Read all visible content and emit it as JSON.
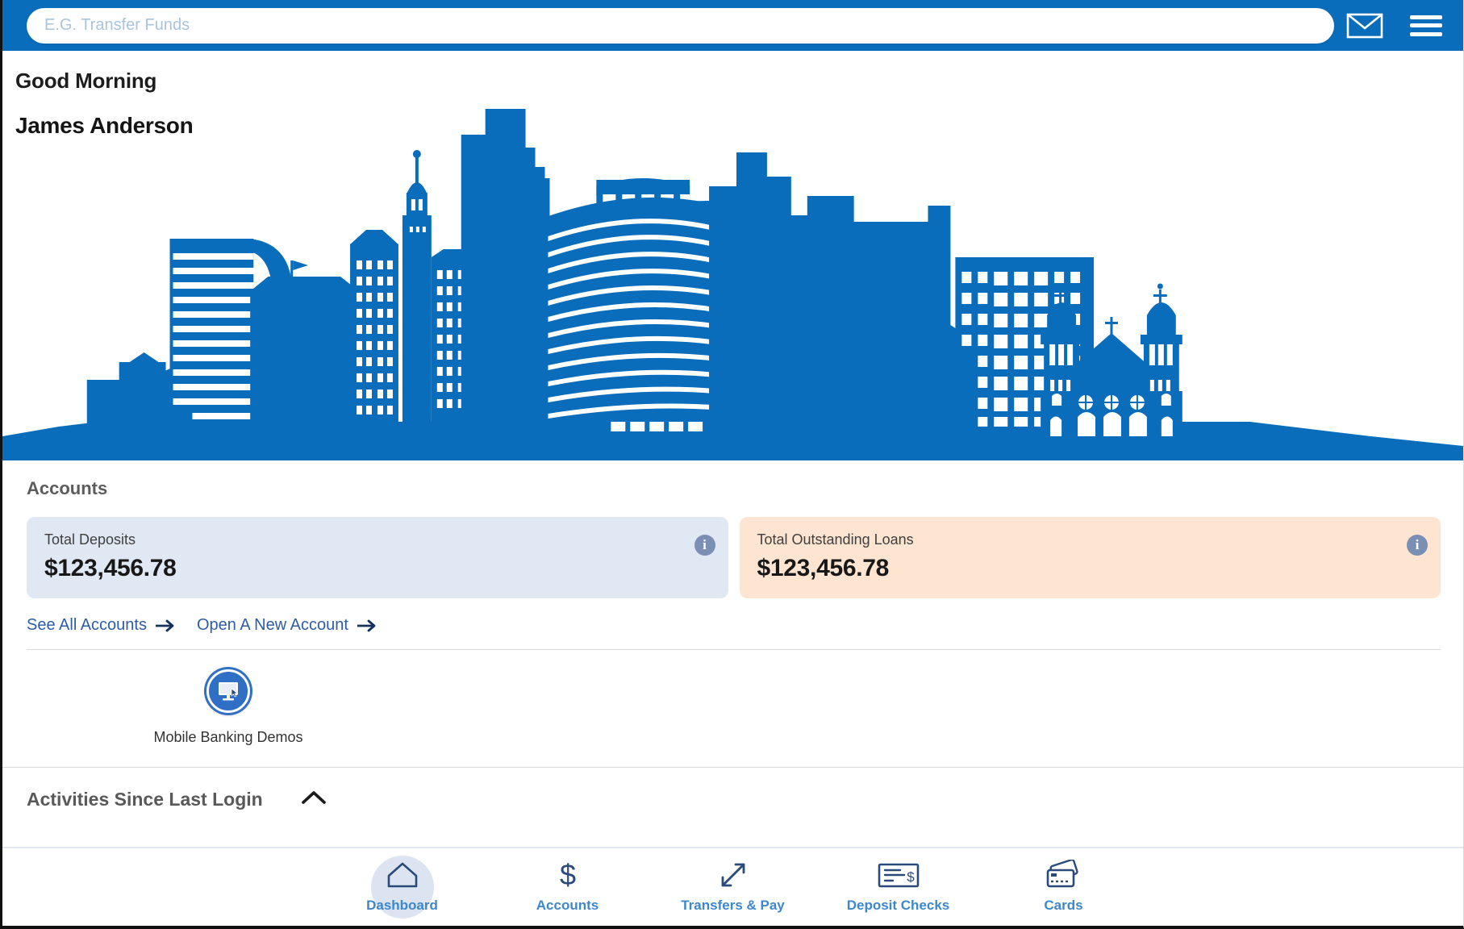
{
  "header": {
    "search_placeholder": "E.G. Transfer Funds",
    "search_value": "",
    "mail_icon": "envelope-icon",
    "menu_icon": "hamburger-menu-icon"
  },
  "hero": {
    "greeting": "Good Morning",
    "user_name": "James Anderson",
    "illustration": "city-skyline-illustration",
    "skyline_color": "#0A6DBB"
  },
  "accounts": {
    "section_title": "Accounts",
    "cards": [
      {
        "label": "Total Deposits",
        "value": "$123,456.78",
        "info_icon": "info-icon",
        "bg_color": "#DFE8F3"
      },
      {
        "label": "Total Outstanding Loans",
        "value": "$123,456.78",
        "info_icon": "info-icon",
        "bg_color": "#FDE5D2"
      }
    ],
    "links": [
      {
        "label": "See All Accounts",
        "icon": "arrow-right-icon"
      },
      {
        "label": "Open A New Account",
        "icon": "arrow-right-icon"
      }
    ]
  },
  "quicklinks": {
    "items": [
      {
        "label": "Mobile Banking Demos",
        "icon": "desktop-monitor-cursor-icon"
      }
    ]
  },
  "activities": {
    "title": "Activities Since Last Login",
    "toggle_icon": "chevron-up-icon",
    "expanded": "true"
  },
  "bottomnav": {
    "active": "Dashboard",
    "items": [
      {
        "label": "Dashboard",
        "icon": "home-icon",
        "active": true
      },
      {
        "label": "Accounts",
        "icon": "dollar-sign-icon",
        "active": false
      },
      {
        "label": "Transfers & Pay",
        "icon": "diagonal-arrows-icon",
        "active": false
      },
      {
        "label": "Deposit Checks",
        "icon": "check-document-icon",
        "active": false
      },
      {
        "label": "Cards",
        "icon": "credit-cards-icon",
        "active": false
      }
    ]
  },
  "theme": {
    "brand_blue": "#0A6DBB",
    "nav_blue": "#3D87CD",
    "link_blue": "#2D5CA8",
    "nav_icon_navy": "#2A4A7C"
  }
}
